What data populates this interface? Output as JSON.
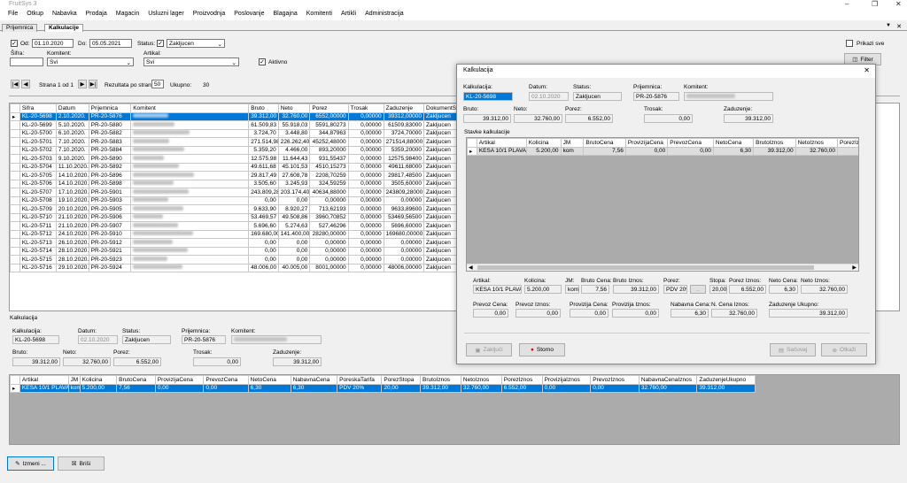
{
  "app": {
    "title": "FruitSys 3"
  },
  "menu": [
    "File",
    "Otkup",
    "Nabavka",
    "Prodaja",
    "Magacin",
    "Usluzni lager",
    "Proizvodnja",
    "Poslovanje",
    "Blagajna",
    "Komitenti",
    "Artikli",
    "Administracija"
  ],
  "tabs": [
    "Prijemnica",
    "Kalkulacije"
  ],
  "filter": {
    "od_label": "Od:",
    "od_value": "01.10.2020",
    "do_label": "Do:",
    "do_value": "05.05.2021",
    "status_label": "Status:",
    "status_value": "Zakljucen",
    "sifra_label": "Šifra:",
    "komitent_label": "Komitent:",
    "komitent_value": "Svi",
    "artikal_label": "Artikal:",
    "artikal_value": "Svi",
    "aktivno_label": "Aktivno",
    "prikazi_svi_label": "Prikazi sve",
    "filter_button": "Filter"
  },
  "pager": {
    "page_text": "Strana 1 od 1",
    "per_page_label": "Rezultata po strani:",
    "per_page_value": "50",
    "total_label": "Ukupno:",
    "total_value": "30"
  },
  "main_grid": {
    "columns": [
      "Sifra",
      "Datum",
      "Prijemnica",
      "Komitent",
      "Bruto",
      "Neto",
      "Porez",
      "Trosak",
      "Zaduzenje",
      "DokumentStatus"
    ],
    "rows": [
      [
        "KL-20-5698",
        "2.10.2020.",
        "PR-20-5876",
        "",
        "39.312,00",
        "32.760,00",
        "6552,00000",
        "0,00000",
        "39312,00000",
        "Zakljucen"
      ],
      [
        "KL-20-5699",
        "5.10.2020.",
        "PR-20-5880",
        "",
        "61.509,83",
        "55.918,03",
        "5591,80273",
        "0,00000",
        "61509,83000",
        "Zakljucen"
      ],
      [
        "KL-20-5700",
        "6.10.2020.",
        "PR-20-5882",
        "",
        "3.724,70",
        "3.448,80",
        "344,87963",
        "0,00000",
        "3724,70000",
        "Zakljucen"
      ],
      [
        "KL-20-5701",
        "7.10.2020.",
        "PR-20-5883",
        "",
        "271.514,98",
        "226.262,40",
        "45252,48000",
        "0,00000",
        "271514,88000",
        "Zakljucen"
      ],
      [
        "KL-20-5702",
        "7.10.2020.",
        "PR-20-5884",
        "",
        "5.359,20",
        "4.466,00",
        "893,20000",
        "0,00000",
        "5359,20000",
        "Zakljucen"
      ],
      [
        "KL-20-5703",
        "9.10.2020.",
        "PR-20-5890",
        "",
        "12.575,98",
        "11.644,43",
        "931,55437",
        "0,00000",
        "12575,98400",
        "Zakljucen"
      ],
      [
        "KL-20-5704",
        "11.10.2020.",
        "PR-20-5892",
        "",
        "49.611,68",
        "45.101,53",
        "4510,15273",
        "0,00000",
        "49611,68000",
        "Zakljucen"
      ],
      [
        "KL-20-5705",
        "14.10.2020.",
        "PR-20-5896",
        "",
        "29.817,49",
        "27.608,78",
        "2208,70259",
        "0,00000",
        "29817,48500",
        "Zakljucen"
      ],
      [
        "KL-20-5706",
        "14.10.2020.",
        "PR-20-5898",
        "",
        "3.505,60",
        "3.245,93",
        "324,59259",
        "0,00000",
        "3505,60000",
        "Zakljucen"
      ],
      [
        "KL-20-5707",
        "17.10.2020.",
        "PR-20-5901",
        "",
        "243.809,28",
        "203.174,40",
        "40634,88000",
        "0,00000",
        "243809,28000",
        "Zakljucen"
      ],
      [
        "KL-20-5708",
        "19.10.2020.",
        "PR-20-5903",
        "",
        "0,00",
        "0,00",
        "0,00000",
        "0,00000",
        "0,00000",
        "Zakljucen"
      ],
      [
        "KL-20-5709",
        "20.10.2020.",
        "PR-20-5905",
        "",
        "9.633,90",
        "8.920,27",
        "713,62193",
        "0,00000",
        "9633,89600",
        "Zakljucen"
      ],
      [
        "KL-20-5710",
        "21.10.2020.",
        "PR-20-5906",
        "",
        "53.469,57",
        "49.508,86",
        "3960,70852",
        "0,00000",
        "53469,56500",
        "Zakljucen"
      ],
      [
        "KL-20-5711",
        "21.10.2020.",
        "PR-20-5907",
        "",
        "5.696,60",
        "5.274,63",
        "527,46296",
        "0,00000",
        "5696,60000",
        "Zakljucen"
      ],
      [
        "KL-20-5712",
        "24.10.2020.",
        "PR-20-5910",
        "",
        "169.680,00",
        "141.400,00",
        "28280,00000",
        "0,00000",
        "169680,00000",
        "Zakljucen"
      ],
      [
        "KL-20-5713",
        "26.10.2020.",
        "PR-20-5912",
        "",
        "0,00",
        "0,00",
        "0,00000",
        "0,00000",
        "0,00000",
        "Zakljucen"
      ],
      [
        "KL-20-5714",
        "28.10.2020.",
        "PR-20-5921",
        "",
        "0,00",
        "0,00",
        "0,00000",
        "0,00000",
        "0,00000",
        "Zakljucen"
      ],
      [
        "KL-20-5715",
        "28.10.2020.",
        "PR-20-5923",
        "",
        "0,00",
        "0,00",
        "0,00000",
        "0,00000",
        "0,00000",
        "Zakljucen"
      ],
      [
        "KL-20-5716",
        "29.10.2020.",
        "PR-20-5924",
        "",
        "48.006,00",
        "40.005,00",
        "8001,00000",
        "0,00000",
        "48006,00000",
        "Zakljucen"
      ]
    ]
  },
  "detail": {
    "section_label": "Kalkulacija",
    "kalkulacija_label": "Kalkulacija:",
    "kalkulacija_value": "KL-20-5698",
    "datum_label": "Datum:",
    "datum_value": "02.10.2020",
    "status_label": "Status:",
    "status_value": "Zakljucen",
    "prijemnica_label": "Prijemnica:",
    "prijemnica_value": "PR-20-5876",
    "komitent_label": "Komitent:",
    "bruto_label": "Bruto:",
    "bruto_value": "39.312,00",
    "neto_label": "Neto:",
    "neto_value": "32.760,00",
    "porez_label": "Porez:",
    "porez_value": "6.552,00",
    "trosak_label": "Trosak:",
    "trosak_value": "0,00",
    "zaduzenje_label": "Zaduzenje:",
    "zaduzenje_value": "39.312,00"
  },
  "items_grid": {
    "columns": [
      "Artikal",
      "JM",
      "Kolicina",
      "BrutoCena",
      "ProvizijaCena",
      "PrevozCena",
      "NetoCena",
      "NabavnaCena",
      "PoreskaTarifa",
      "PorezStopa",
      "BrutoIznos",
      "NetoIznos",
      "PorezIznos",
      "ProvizijaIznos",
      "PrevozIznos",
      "NabavnaCenaIznos",
      "ZaduzenjeUkupno"
    ],
    "rows": [
      [
        "KESA 10/1 PLAVA",
        "kom",
        "5.200,00",
        "7,56",
        "0,00",
        "0,00",
        "6,30",
        "6,30",
        "PDV 20%",
        "20,00",
        "39.312,00",
        "32.760,00",
        "6.552,00",
        "0,00",
        "0,00",
        "32.760,00",
        "39.312,00"
      ]
    ]
  },
  "bottom_buttons": {
    "izmeni": "Izmeni ...",
    "brisi": "Briši"
  },
  "dialog": {
    "title": "Kalkulacija",
    "kalkulacija_label": "Kalkulacija:",
    "kalkulacija_value": "KL-20-5698",
    "datum_label": "Datum:",
    "datum_value": "02.10.2020",
    "status_label": "Status:",
    "status_value": "Zakljucen",
    "prijemnica_label": "Prijemnica:",
    "prijemnica_value": "PR-20-5876",
    "komitent_label": "Komitent:",
    "bruto_label": "Bruto:",
    "bruto_value": "39.312,00",
    "neto_label": "Neto:",
    "neto_value": "32.760,00",
    "porez_label": "Porez:",
    "porez_value": "6.552,00",
    "trosak_label": "Trosak:",
    "trosak_value": "0,00",
    "zaduzenje_label": "Zaduzenje:",
    "zaduzenje_value": "39.312,00",
    "stavke_label": "Stavke kalkulacije",
    "grid_columns": [
      "Artikal",
      "Kolicina",
      "JM",
      "BrutoCena",
      "ProvizijaCena",
      "PrevozCena",
      "NetoCena",
      "BrutoIznos",
      "NetoIznos",
      "PorezIz"
    ],
    "grid_rows": [
      [
        "KESA 10/1 PLAVA",
        "5.200,00",
        "kom",
        "7,56",
        "0,00",
        "0,00",
        "6,30",
        "39.312,00",
        "32.760,00",
        ""
      ]
    ],
    "f_artikal_label": "Artikal:",
    "f_artikal_value": "KESA 10/1 PLAVA",
    "f_kolicina_label": "Kolicina:",
    "f_kolicina_value": "5.200,00",
    "f_jm_label": "JM:",
    "f_jm_value": "kom",
    "f_brutocena_label": "Bruto Cena:",
    "f_brutocena_value": "7,56",
    "f_brutoiznos_label": "Bruto Iznos:",
    "f_brutoiznos_value": "39.312,00",
    "f_porez_label": "Porez:",
    "f_porez_value": "PDV 20%",
    "f_stopa_label": "Stopa:",
    "f_stopa_value": "20,00",
    "f_poreziznos_label": "Porez Iznos:",
    "f_poreziznos_value": "6.552,00",
    "f_netocena_label": "Neto Cena:",
    "f_netocena_value": "6,30",
    "f_netoiznos_label": "Neto Iznos:",
    "f_netoiznos_value": "32.760,00",
    "f_prevozcena_label": "Prevoz Cena:",
    "f_prevozcena_value": "0,00",
    "f_previznos_label": "Prevoz Iznos:",
    "f_previznos_value": "0,00",
    "f_provcena_label": "Provizija Cena:",
    "f_provcena_value": "0,00",
    "f_proviznos_label": "Provizija Iznos:",
    "f_proviznos_value": "0,00",
    "f_nabcena_label": "Nabavna Cena:",
    "f_nabcena_value": "6,30",
    "f_ncena_label": "N. Cena Iznos:",
    "f_ncena_value": "32.760,00",
    "f_zaduk_label": "Zaduzenje Ukupno:",
    "f_zaduk_value": "39.312,00",
    "btn_zakljuci": "Zaključi",
    "btn_storno": "Storno",
    "btn_sacuvaj": "Sačuvaj",
    "btn_otkazi": "Otkaži"
  }
}
